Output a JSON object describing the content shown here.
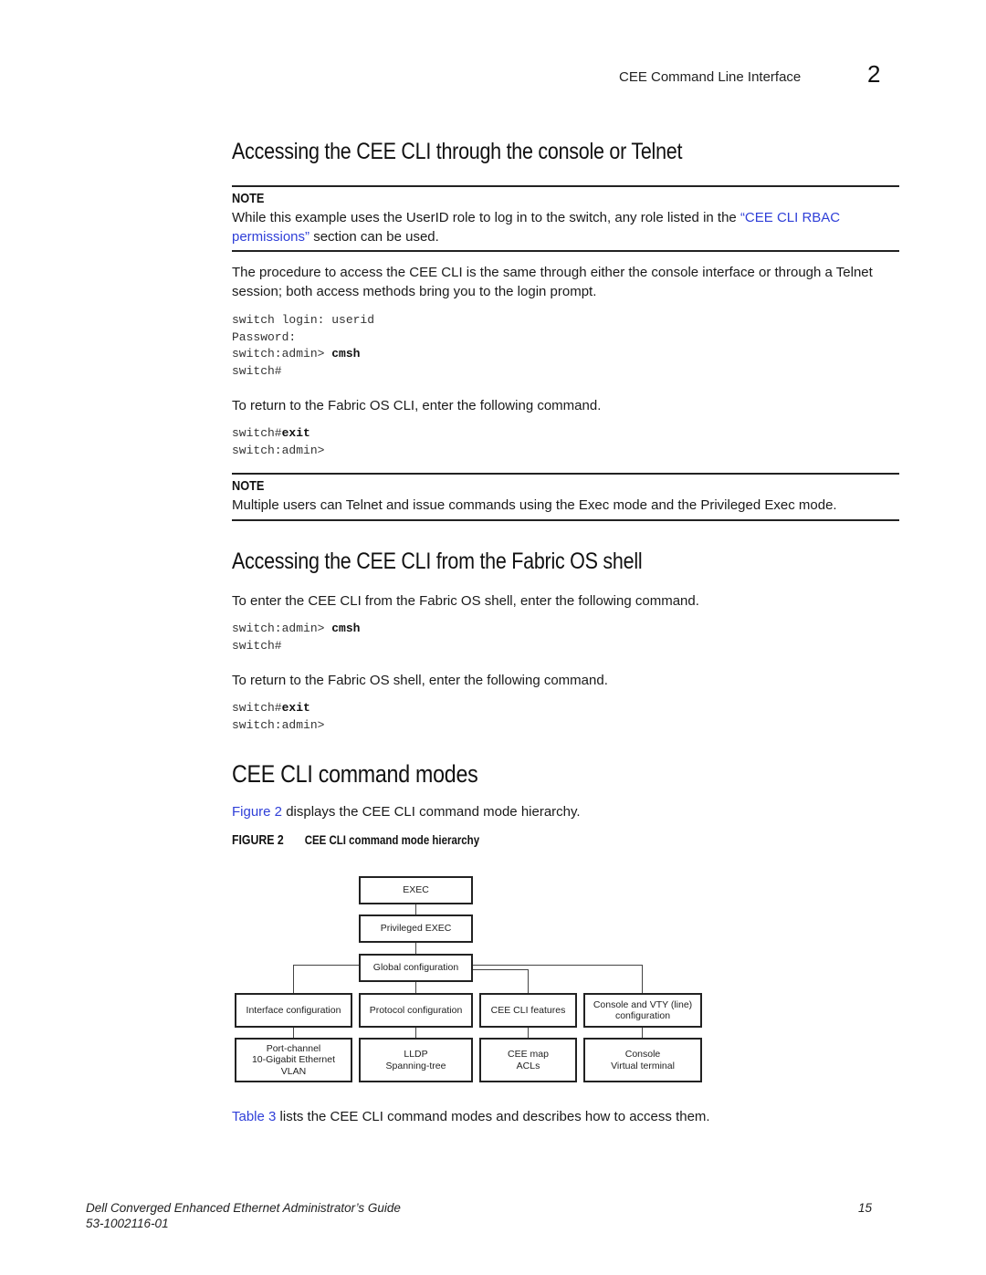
{
  "header": {
    "chapter_title": "CEE Command Line Interface",
    "chapter_number": "2"
  },
  "section1": {
    "heading": "Accessing the CEE CLI through the console or Telnet",
    "note": {
      "label": "NOTE",
      "text_before": "While this example uses the UserID role to log in to the switch, any role listed in the ",
      "link_text": "“CEE CLI RBAC permissions”",
      "text_after": " section can be used."
    },
    "paragraph": "The procedure to access the CEE CLI is the same through either the console interface or through a Telnet session; both access methods bring you to the login prompt.",
    "code1": {
      "line1": "switch login: userid",
      "line2": "Password:",
      "line3_prefix": "switch:admin> ",
      "line3_cmd": "cmsh",
      "line4": "switch#"
    },
    "return_text": "To return to the Fabric OS CLI, enter the following command.",
    "code2": {
      "line1_prefix": "switch#",
      "line1_cmd": "exit",
      "line2": "switch:admin>"
    },
    "note2": {
      "label": "NOTE",
      "text": "Multiple users can Telnet and issue commands using the Exec mode and the Privileged Exec mode."
    }
  },
  "section2": {
    "heading": "Accessing the CEE CLI from the Fabric OS shell",
    "enter_text": "To enter the CEE CLI from the Fabric OS shell, enter the following command.",
    "code1": {
      "line1_prefix": "switch:admin> ",
      "line1_cmd": "cmsh",
      "line2": "switch#"
    },
    "return_text": "To return to the Fabric OS shell, enter the following command.",
    "code2": {
      "line1_prefix": "switch#",
      "line1_cmd": "exit",
      "line2": "switch:admin>"
    }
  },
  "section3": {
    "heading": "CEE CLI command modes",
    "intro_link": "Figure 2",
    "intro_text": " displays the CEE CLI command mode hierarchy.",
    "figure_label": "FIGURE 2",
    "figure_title": "CEE CLI command mode hierarchy",
    "diagram": {
      "exec": "EXEC",
      "privileged_exec": "Privileged EXEC",
      "global_config": "Global configuration",
      "modes": [
        {
          "name": "Interface configuration",
          "children": [
            "Port-channel",
            "10-Gigabit Ethernet",
            "VLAN"
          ]
        },
        {
          "name": "Protocol configuration",
          "children": [
            "LLDP",
            "Spanning-tree"
          ]
        },
        {
          "name": "CEE CLI features",
          "children": [
            "CEE map",
            "ACLs"
          ]
        },
        {
          "name_line1": "Console and VTY (line)",
          "name_line2": "configuration",
          "children": [
            "Console",
            "Virtual terminal"
          ]
        }
      ]
    },
    "table_link": "Table 3",
    "table_text": " lists the CEE CLI command modes and describes how to access them."
  },
  "footer": {
    "guide_title": "Dell Converged Enhanced Ethernet Administrator’s Guide",
    "doc_number": "53-1002116-01",
    "page_number": "15"
  },
  "colors": {
    "link": "#2f3fd8",
    "text": "#1a1a1a",
    "rule": "#222222"
  }
}
